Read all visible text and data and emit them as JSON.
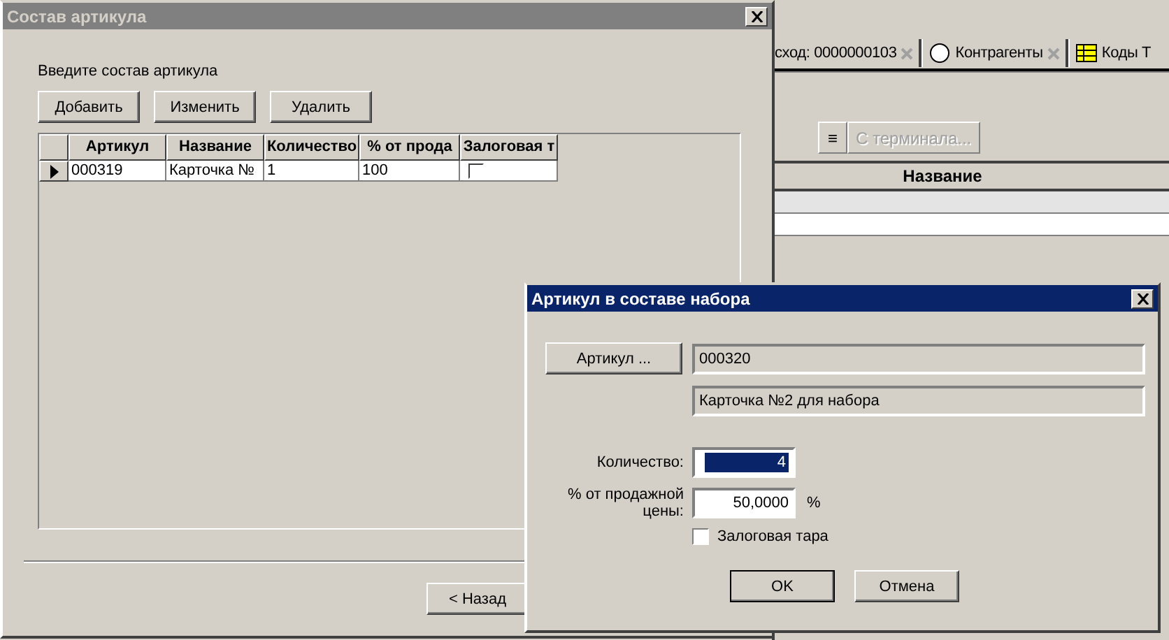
{
  "background_window": {
    "tabs": [
      {
        "kind": "text",
        "label": "сход: 0000000103"
      },
      {
        "kind": "person",
        "label": "Контрагенты"
      },
      {
        "kind": "table",
        "label": "Коды Т"
      }
    ],
    "toolbar": {
      "menu_button": "≡",
      "terminal_button": {
        "label": "С терминала...",
        "disabled": true
      }
    },
    "table": {
      "columns": [
        "Название"
      ],
      "rows": [
        {
          "selected": true
        },
        {
          "selected": false
        }
      ]
    }
  },
  "composition_dialog": {
    "title": "Состав артикула",
    "active": false,
    "prompt": "Введите состав артикула",
    "buttons": [
      "Добавить",
      "Изменить",
      "Удалить"
    ],
    "grid": {
      "columns": [
        "Артикул",
        "Название",
        "Количество",
        "% от прода",
        "Залоговая т"
      ],
      "rows": [
        {
          "current": true,
          "cells": [
            "000319",
            "Карточка №",
            "1",
            "100"
          ],
          "deposit": false
        }
      ]
    },
    "back_button": "< Назад"
  },
  "item_dialog": {
    "title": "Артикул в составе набора",
    "active": true,
    "article_button": "Артикул ...",
    "article_code": "000320",
    "article_name": "Карточка №2 для набора",
    "quantity_label": "Количество:",
    "quantity": "4",
    "percent_label": "% от продажной цены:",
    "percent": "50,0000",
    "percent_unit": "%",
    "deposit": {
      "label": "Залоговая тара",
      "checked": false
    },
    "ok_button": "OK",
    "cancel_button": "Отмена"
  }
}
